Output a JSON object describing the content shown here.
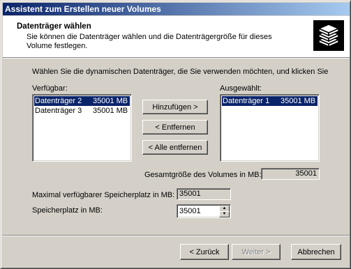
{
  "window": {
    "title": "Assistent zum Erstellen neuer Volumes"
  },
  "header": {
    "title": "Datenträger wählen",
    "description": "Sie können die Datenträger wählen und die Datenträgergröße für dieses Volume festlegen.",
    "icon": "disk-stack-icon"
  },
  "instruction": "Wählen Sie die dynamischen Datenträger, die Sie verwenden möchten, und klicken Sie",
  "available": {
    "label": "Verfügbar:",
    "items": [
      {
        "name": "Datenträger 2",
        "size": "35001 MB",
        "selected": true
      },
      {
        "name": "Datenträger 3",
        "size": "35001 MB",
        "selected": false
      }
    ]
  },
  "selected_list": {
    "label": "Ausgewählt:",
    "items": [
      {
        "name": "Datenträger 1",
        "size": "35001 MB",
        "selected": true
      }
    ]
  },
  "actions": {
    "add": "Hinzufügen >",
    "remove": "< Entfernen",
    "remove_all": "< Alle entfernen"
  },
  "total_size": {
    "label": "Gesamtgröße des Volumes in MB:",
    "value": "35001"
  },
  "max_space": {
    "label": "Maximal verfügbarer Speicherplatz in MB:",
    "value": "35001"
  },
  "space": {
    "label": "Speicherplatz in MB:",
    "value": "35001"
  },
  "footer": {
    "back": "< Zurück",
    "next": "Weiter >",
    "cancel": "Abbrechen"
  },
  "colors": {
    "titlebar": "#0a246a",
    "selection": "#0a246a",
    "face": "#d4d0c8"
  }
}
